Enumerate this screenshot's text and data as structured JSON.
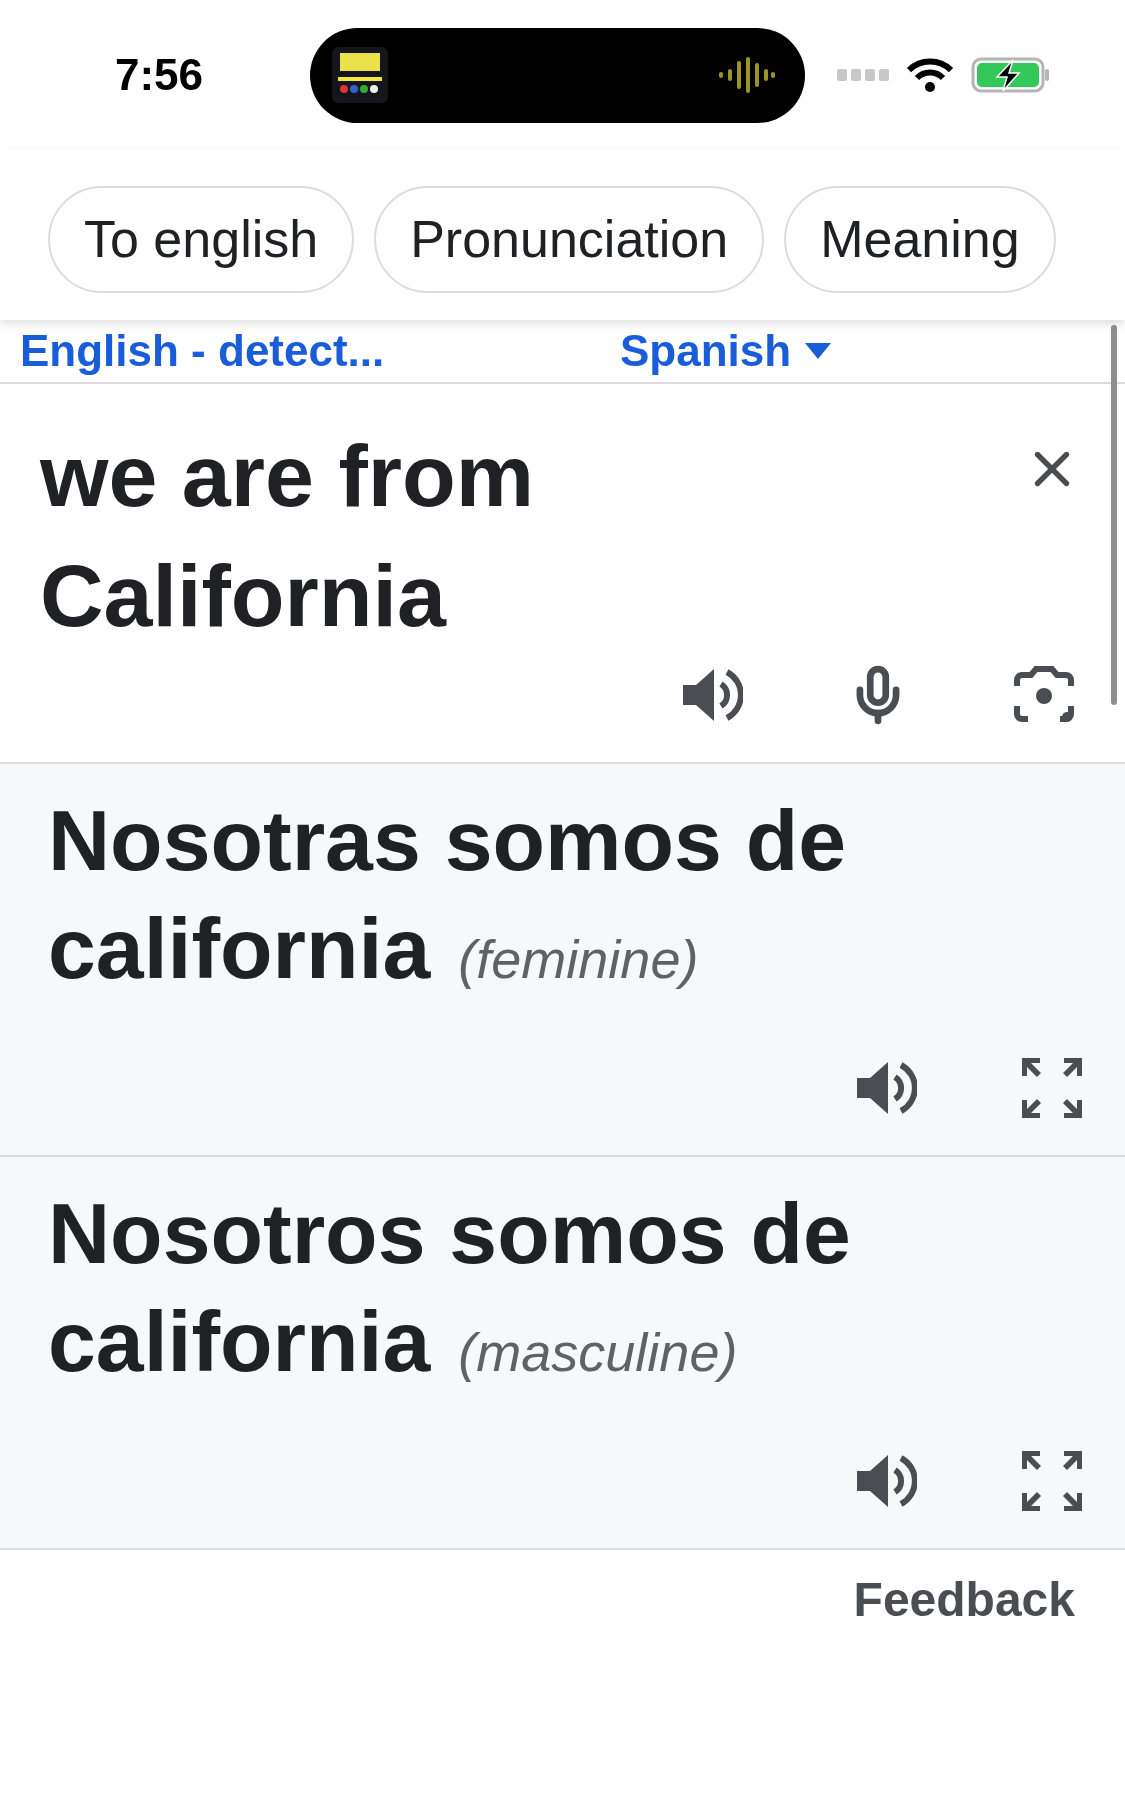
{
  "status_bar": {
    "time": "7:56"
  },
  "chips": [
    {
      "label": "To english"
    },
    {
      "label": "Pronunciation"
    },
    {
      "label": "Meaning"
    }
  ],
  "languages": {
    "source": "English - detect...",
    "target": "Spanish"
  },
  "input": {
    "value": "we are from California"
  },
  "translations": [
    {
      "text": "Nosotras somos de california",
      "note": "(feminine)"
    },
    {
      "text": "Nosotros somos de california",
      "note": "(masculine)"
    }
  ],
  "feedback": "Feedback"
}
